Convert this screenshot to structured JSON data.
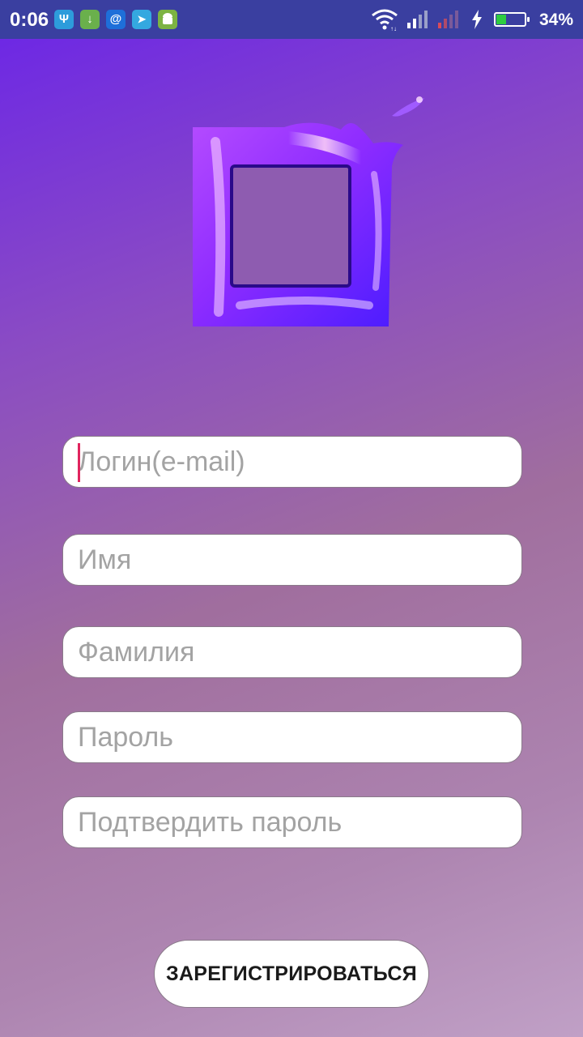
{
  "status_bar": {
    "time": "0:06",
    "battery": "34%",
    "battery_level": 0.34,
    "notifications": [
      {
        "icon": "usb-icon",
        "glyph": "Ψ",
        "color": "#2d9cdb"
      },
      {
        "icon": "download-icon",
        "glyph": "↓",
        "color": "#6ab04c"
      },
      {
        "icon": "email-icon",
        "glyph": "@",
        "color": "#1e6fd9"
      },
      {
        "icon": "telegram-icon",
        "glyph": "➤",
        "color": "#34a8e0"
      },
      {
        "icon": "android-icon",
        "glyph": "◙",
        "color": "#7cb342"
      }
    ]
  },
  "form": {
    "login_placeholder": "Логин(e-mail)",
    "first_name_placeholder": "Имя",
    "last_name_placeholder": "Фамилия",
    "password_placeholder": "Пароль",
    "confirm_password_placeholder": "Подтвердить пароль",
    "submit_label": "ЗАРЕГИСТРИРОВАТЬСЯ"
  },
  "colors": {
    "accent_cursor": "#e0245e",
    "status_bar": "#3a3fa0"
  }
}
